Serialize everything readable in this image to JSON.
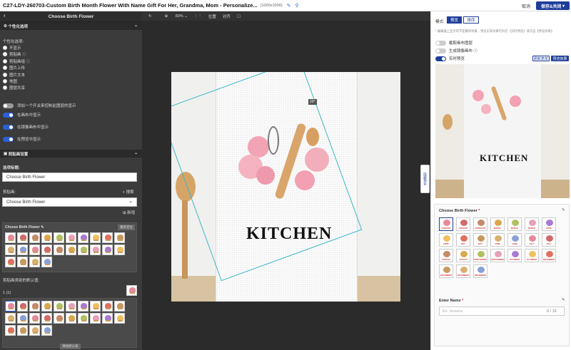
{
  "topbar": {
    "title": "C27-LDY-260703-Custom Birth Month Flower With Name Gift For Her, Grandma, Mom - Personalize...",
    "dims": "(1000x1000)",
    "cancel": "取消",
    "save": "保存&关闭"
  },
  "left": {
    "header": "Choose Birth Flower",
    "section1": "个性化选项",
    "options_label": "个性化选项:",
    "options": [
      "不显示",
      "剪贴画 ⓘ",
      "剪贴画组 ⓘ",
      "图片上传",
      "图片文本",
      "地图",
      "图层共享"
    ],
    "selected_option": 1,
    "toggle1": "添加一个开关来控制此图层的显示",
    "toggle2": "在画布中显示",
    "toggle3": "在镜像画布中显示",
    "toggle4": "在预览中显示",
    "section2": "剪贴画设置",
    "title_label": "选项标题:",
    "title_value": "Choose Birth Flower",
    "clipart_label": "剪贴画:",
    "search": "搜索",
    "clipart_value": "Choose Birth Flower",
    "add": "新增",
    "group_title": "Choose Birth Flower",
    "reposition": "重新定位",
    "default_label": "剪贴画类别的默认值:",
    "count": "1 (1)",
    "clear_default": "清除默认值"
  },
  "canvas": {
    "zoom": "83%",
    "position": "位置",
    "align": "对齐",
    "kitchen": "KITCHEN",
    "rotate_tag": "20°"
  },
  "right": {
    "mode_label": "模式:",
    "tab_preview": "预览",
    "tab_sort": "排序",
    "hint": "* 编辑器上显示的不是最终效果，预览实际效果可开启【实时预览】或点击【预览效果】",
    "t1": "截取画布图层",
    "t2": "生成镜像画布 ⓘ",
    "t3": "实时预览",
    "refresh": "刷新表单",
    "preview_btn": "预览效果",
    "side_tab": "隐藏预览",
    "product_text": "KITCHEN",
    "flower_label": "Choose Birth Flower",
    "months": [
      "JANUARY",
      "JANUARY",
      "FEBRUARY",
      "MARCH",
      "MARCH",
      "MARCH",
      "APRIL",
      "APRIL",
      "MAY",
      "MAY",
      "JUNE",
      "JUNE",
      "JULY",
      "JULY",
      "AUGUST",
      "AUGUST",
      "SEPTEMBER",
      "SEPTEMBER",
      "OCTOBER",
      "OCTOBER",
      "NOVEMBER",
      "NOVEMBER",
      "DECEMBER",
      "DECEMBER"
    ],
    "name_label": "Enter Name",
    "name_placeholder": "Ex: Jessica",
    "name_count": "0 / 15"
  },
  "colors": {
    "accent": "#1f3e9a",
    "panel": "#3b3b3b",
    "canvas": "#2b2b2b"
  }
}
